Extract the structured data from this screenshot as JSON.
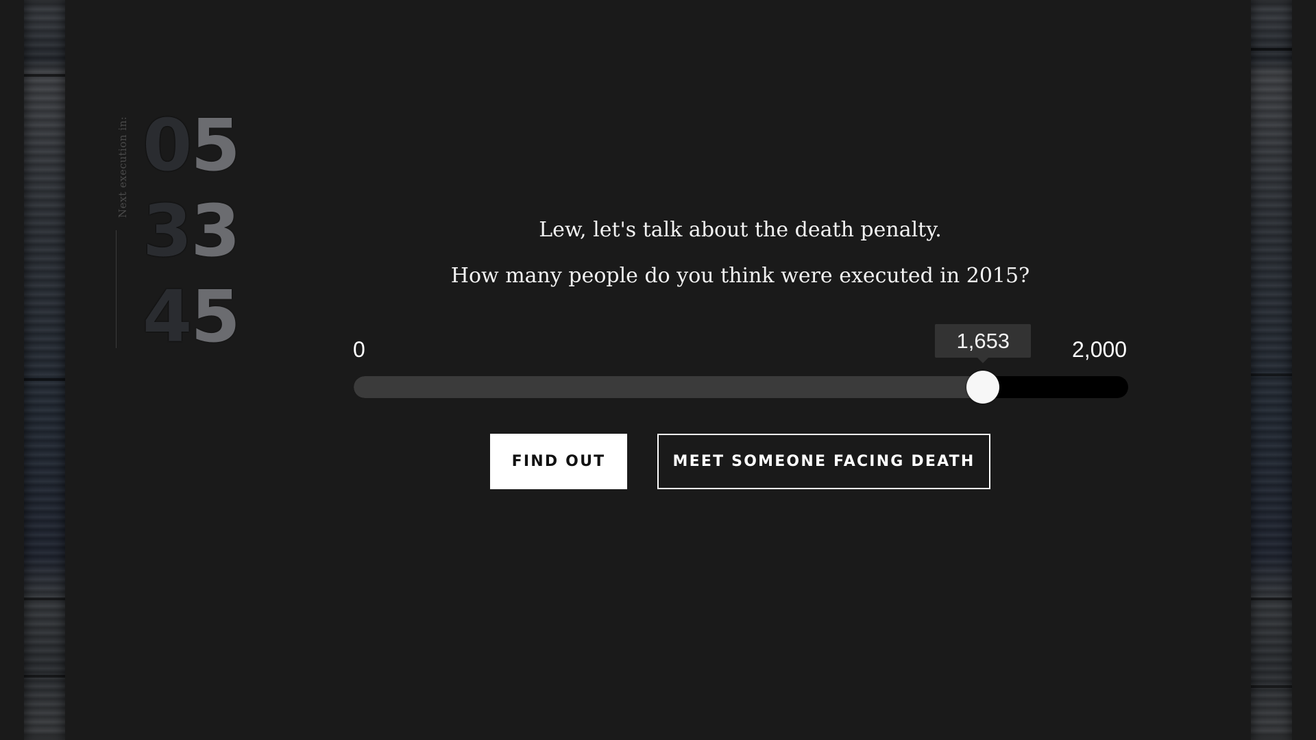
{
  "countdown": {
    "label": "Next execution in:",
    "rows": [
      {
        "d1": "0",
        "d2": "5"
      },
      {
        "d1": "3",
        "d2": "3"
      },
      {
        "d1": "4",
        "d2": "5"
      }
    ]
  },
  "intro": {
    "greeting": "Lew, let's talk about the death penalty.",
    "question": "How many people do you think were executed in 2015?"
  },
  "slider": {
    "min_label": "0",
    "max_label": "2,000",
    "min": 0,
    "max": 2000,
    "value": 1653,
    "value_label": "1,653"
  },
  "buttons": {
    "find_out": "FIND OUT",
    "meet_someone": "MEET SOMEONE FACING DEATH"
  },
  "colors": {
    "background": "#1a1a1a",
    "track": "#000000",
    "track_fill": "#3b3b3b",
    "thumb": "#f7f7f7",
    "text": "#f2f2f2"
  }
}
